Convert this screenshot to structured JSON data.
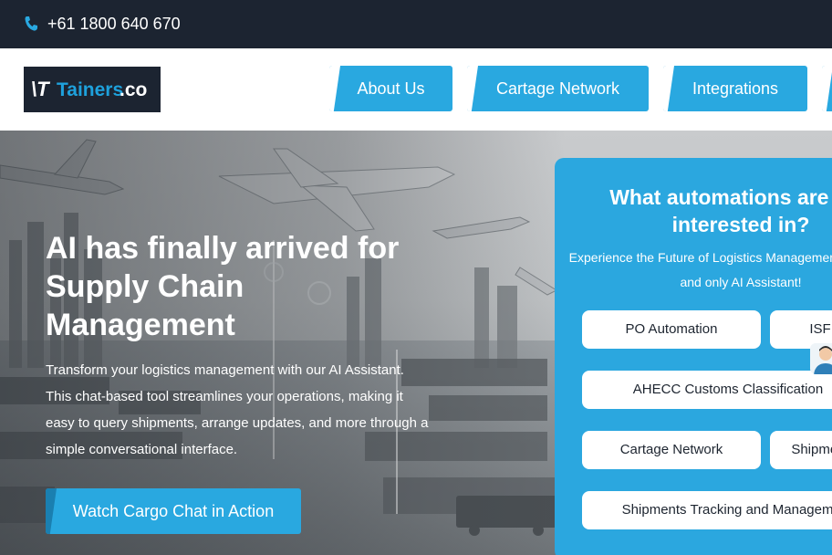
{
  "topbar": {
    "phone": "+61 1800 640 670",
    "icon": "phone-icon"
  },
  "header": {
    "logo": {
      "mark": "\\T",
      "tainers": "Tainers",
      "co": ".co"
    },
    "nav": [
      {
        "label": "About Us"
      },
      {
        "label": "Cartage Network"
      },
      {
        "label": "Integrations"
      }
    ]
  },
  "hero": {
    "headline": "AI has finally arrived for Supply Chain Management",
    "subtext": "Transform your logistics management with our AI Assistant. This chat-based tool streamlines your operations, making it easy to query shipments, arrange updates, and more through a simple conversational interface.",
    "cta": "Watch Cargo Chat in Action"
  },
  "panel": {
    "title": "What automations are you interested in?",
    "subtitle": "Experience the Future of Logistics Management with the one and only AI Assistant!",
    "chips": [
      {
        "label": "PO Automation"
      },
      {
        "label": "ISF"
      },
      {
        "label": "AHECC Customs Classification"
      },
      {
        "label": "Cartage Network"
      },
      {
        "label": "Shipment"
      },
      {
        "label": "Shipments Tracking and Management"
      }
    ]
  },
  "colors": {
    "dark": "#1c2431",
    "accent": "#29a8e0"
  }
}
